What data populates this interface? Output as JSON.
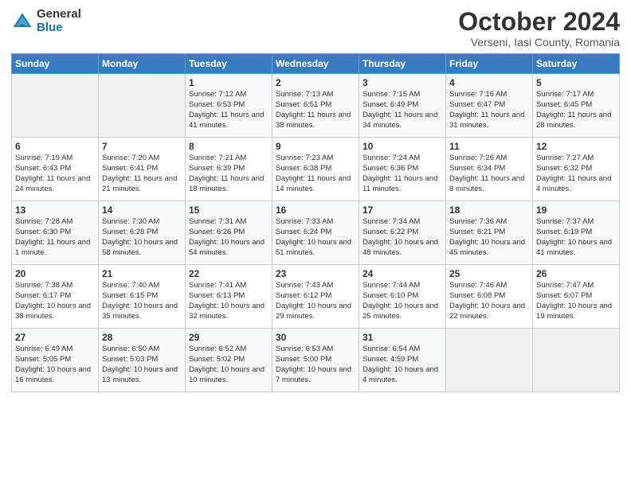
{
  "header": {
    "logo_general": "General",
    "logo_blue": "Blue",
    "month_title": "October 2024",
    "location": "Verseni, Iasi County, Romania"
  },
  "days_of_week": [
    "Sunday",
    "Monday",
    "Tuesday",
    "Wednesday",
    "Thursday",
    "Friday",
    "Saturday"
  ],
  "weeks": [
    [
      {
        "day": "",
        "content": ""
      },
      {
        "day": "",
        "content": ""
      },
      {
        "day": "1",
        "content": "Sunrise: 7:12 AM\nSunset: 6:53 PM\nDaylight: 11 hours and 41 minutes."
      },
      {
        "day": "2",
        "content": "Sunrise: 7:13 AM\nSunset: 6:51 PM\nDaylight: 11 hours and 38 minutes."
      },
      {
        "day": "3",
        "content": "Sunrise: 7:15 AM\nSunset: 6:49 PM\nDaylight: 11 hours and 34 minutes."
      },
      {
        "day": "4",
        "content": "Sunrise: 7:16 AM\nSunset: 6:47 PM\nDaylight: 11 hours and 31 minutes."
      },
      {
        "day": "5",
        "content": "Sunrise: 7:17 AM\nSunset: 6:45 PM\nDaylight: 11 hours and 28 minutes."
      }
    ],
    [
      {
        "day": "6",
        "content": "Sunrise: 7:19 AM\nSunset: 6:43 PM\nDaylight: 11 hours and 24 minutes."
      },
      {
        "day": "7",
        "content": "Sunrise: 7:20 AM\nSunset: 6:41 PM\nDaylight: 11 hours and 21 minutes."
      },
      {
        "day": "8",
        "content": "Sunrise: 7:21 AM\nSunset: 6:39 PM\nDaylight: 11 hours and 18 minutes."
      },
      {
        "day": "9",
        "content": "Sunrise: 7:23 AM\nSunset: 6:38 PM\nDaylight: 11 hours and 14 minutes."
      },
      {
        "day": "10",
        "content": "Sunrise: 7:24 AM\nSunset: 6:36 PM\nDaylight: 11 hours and 11 minutes."
      },
      {
        "day": "11",
        "content": "Sunrise: 7:26 AM\nSunset: 6:34 PM\nDaylight: 11 hours and 8 minutes."
      },
      {
        "day": "12",
        "content": "Sunrise: 7:27 AM\nSunset: 6:32 PM\nDaylight: 11 hours and 4 minutes."
      }
    ],
    [
      {
        "day": "13",
        "content": "Sunrise: 7:28 AM\nSunset: 6:30 PM\nDaylight: 11 hours and 1 minute."
      },
      {
        "day": "14",
        "content": "Sunrise: 7:30 AM\nSunset: 6:28 PM\nDaylight: 10 hours and 58 minutes."
      },
      {
        "day": "15",
        "content": "Sunrise: 7:31 AM\nSunset: 6:26 PM\nDaylight: 10 hours and 54 minutes."
      },
      {
        "day": "16",
        "content": "Sunrise: 7:33 AM\nSunset: 6:24 PM\nDaylight: 10 hours and 51 minutes."
      },
      {
        "day": "17",
        "content": "Sunrise: 7:34 AM\nSunset: 6:22 PM\nDaylight: 10 hours and 48 minutes."
      },
      {
        "day": "18",
        "content": "Sunrise: 7:36 AM\nSunset: 6:21 PM\nDaylight: 10 hours and 45 minutes."
      },
      {
        "day": "19",
        "content": "Sunrise: 7:37 AM\nSunset: 6:19 PM\nDaylight: 10 hours and 41 minutes."
      }
    ],
    [
      {
        "day": "20",
        "content": "Sunrise: 7:38 AM\nSunset: 6:17 PM\nDaylight: 10 hours and 38 minutes."
      },
      {
        "day": "21",
        "content": "Sunrise: 7:40 AM\nSunset: 6:15 PM\nDaylight: 10 hours and 35 minutes."
      },
      {
        "day": "22",
        "content": "Sunrise: 7:41 AM\nSunset: 6:13 PM\nDaylight: 10 hours and 32 minutes."
      },
      {
        "day": "23",
        "content": "Sunrise: 7:43 AM\nSunset: 6:12 PM\nDaylight: 10 hours and 29 minutes."
      },
      {
        "day": "24",
        "content": "Sunrise: 7:44 AM\nSunset: 6:10 PM\nDaylight: 10 hours and 25 minutes."
      },
      {
        "day": "25",
        "content": "Sunrise: 7:46 AM\nSunset: 6:08 PM\nDaylight: 10 hours and 22 minutes."
      },
      {
        "day": "26",
        "content": "Sunrise: 7:47 AM\nSunset: 6:07 PM\nDaylight: 10 hours and 19 minutes."
      }
    ],
    [
      {
        "day": "27",
        "content": "Sunrise: 6:49 AM\nSunset: 5:05 PM\nDaylight: 10 hours and 16 minutes."
      },
      {
        "day": "28",
        "content": "Sunrise: 6:50 AM\nSunset: 5:03 PM\nDaylight: 10 hours and 13 minutes."
      },
      {
        "day": "29",
        "content": "Sunrise: 6:52 AM\nSunset: 5:02 PM\nDaylight: 10 hours and 10 minutes."
      },
      {
        "day": "30",
        "content": "Sunrise: 6:53 AM\nSunset: 5:00 PM\nDaylight: 10 hours and 7 minutes."
      },
      {
        "day": "31",
        "content": "Sunrise: 6:54 AM\nSunset: 4:59 PM\nDaylight: 10 hours and 4 minutes."
      },
      {
        "day": "",
        "content": ""
      },
      {
        "day": "",
        "content": ""
      }
    ]
  ]
}
